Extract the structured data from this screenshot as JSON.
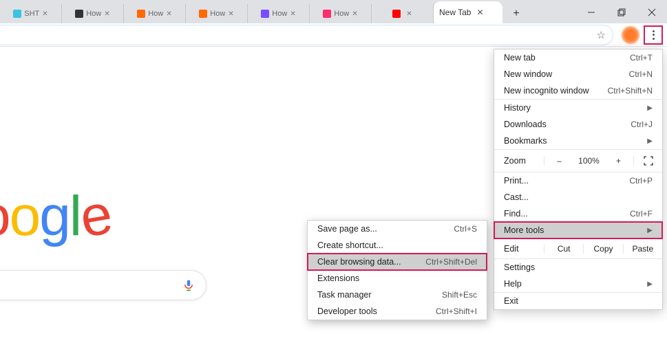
{
  "tabs": {
    "background": [
      {
        "label": "SHT",
        "favicon": "#39c4e0"
      },
      {
        "label": "How",
        "favicon": "#333333"
      },
      {
        "label": "How",
        "favicon": "#ff6a00"
      },
      {
        "label": "How",
        "favicon": "#ff6a00"
      },
      {
        "label": "How",
        "favicon": "#7a4cff"
      },
      {
        "label": "How",
        "favicon": "#ff2d6a"
      },
      {
        "label": "",
        "favicon": "#ff0000"
      }
    ],
    "active": {
      "label": "New Tab"
    }
  },
  "page": {
    "logo": {
      "g1": "o",
      "g2": "o",
      "g3": "g",
      "g4": "l",
      "g5": "e"
    }
  },
  "menu": {
    "new_tab": {
      "label": "New tab",
      "shortcut": "Ctrl+T"
    },
    "new_window": {
      "label": "New window",
      "shortcut": "Ctrl+N"
    },
    "incognito": {
      "label": "New incognito window",
      "shortcut": "Ctrl+Shift+N"
    },
    "history": {
      "label": "History"
    },
    "downloads": {
      "label": "Downloads",
      "shortcut": "Ctrl+J"
    },
    "bookmarks": {
      "label": "Bookmarks"
    },
    "zoom": {
      "label": "Zoom",
      "minus": "–",
      "value": "100%",
      "plus": "+"
    },
    "print": {
      "label": "Print...",
      "shortcut": "Ctrl+P"
    },
    "cast": {
      "label": "Cast..."
    },
    "find": {
      "label": "Find...",
      "shortcut": "Ctrl+F"
    },
    "more_tools": {
      "label": "More tools"
    },
    "edit": {
      "label": "Edit",
      "cut": "Cut",
      "copy": "Copy",
      "paste": "Paste"
    },
    "settings": {
      "label": "Settings"
    },
    "help": {
      "label": "Help"
    },
    "exit": {
      "label": "Exit"
    }
  },
  "submenu": {
    "save_page": {
      "label": "Save page as...",
      "shortcut": "Ctrl+S"
    },
    "create_shortcut": {
      "label": "Create shortcut..."
    },
    "clear_browsing": {
      "label": "Clear browsing data...",
      "shortcut": "Ctrl+Shift+Del"
    },
    "extensions": {
      "label": "Extensions"
    },
    "task_manager": {
      "label": "Task manager",
      "shortcut": "Shift+Esc"
    },
    "dev_tools": {
      "label": "Developer tools",
      "shortcut": "Ctrl+Shift+I"
    }
  }
}
